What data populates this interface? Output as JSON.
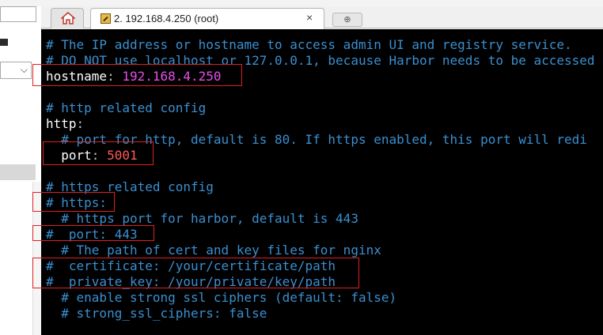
{
  "tabs": {
    "home_icon": "home-icon",
    "active_title": "2. 192.168.4.250 (root)",
    "close_glyph": "×",
    "new_tab_glyph": "⊕"
  },
  "left_panel": {
    "select_chevron": "⌵"
  },
  "terminal": {
    "lines": [
      {
        "comment": "# The IP address or hostname to access admin UI and registry service."
      },
      {
        "comment": "# DO NOT use localhost or 127.0.0.1, because Harbor needs to be accessed"
      },
      {
        "key": "hostname",
        "colon": ": ",
        "value": "192.168.4.250"
      },
      {
        "comment": "# http related config"
      },
      {
        "key": "http",
        "colon": ":"
      },
      {
        "comment": "  # port for http, default is 80. If https enabled, this port will redi"
      },
      {
        "key": "  port",
        "colon": ": ",
        "value": "5001"
      },
      {
        "comment": "# https related config"
      },
      {
        "comment": "# https:"
      },
      {
        "comment": "  # https port for harbor, default is 443"
      },
      {
        "comment": "#  port: 443"
      },
      {
        "comment": "  # The path of cert and key files for nginx"
      },
      {
        "comment": "#  certificate: /your/certificate/path"
      },
      {
        "comment": "#  private_key: /your/private/key/path"
      },
      {
        "comment": "  # enable strong ssl ciphers (default: false)"
      },
      {
        "comment": "  # strong_ssl_ciphers: false"
      }
    ]
  },
  "colors": {
    "comment": "#3a8fd0",
    "key": "#ffffff",
    "ip_value": "#e84ee8",
    "port_value": "#ff5a5a",
    "highlight": "#e02020",
    "background": "#000000"
  }
}
